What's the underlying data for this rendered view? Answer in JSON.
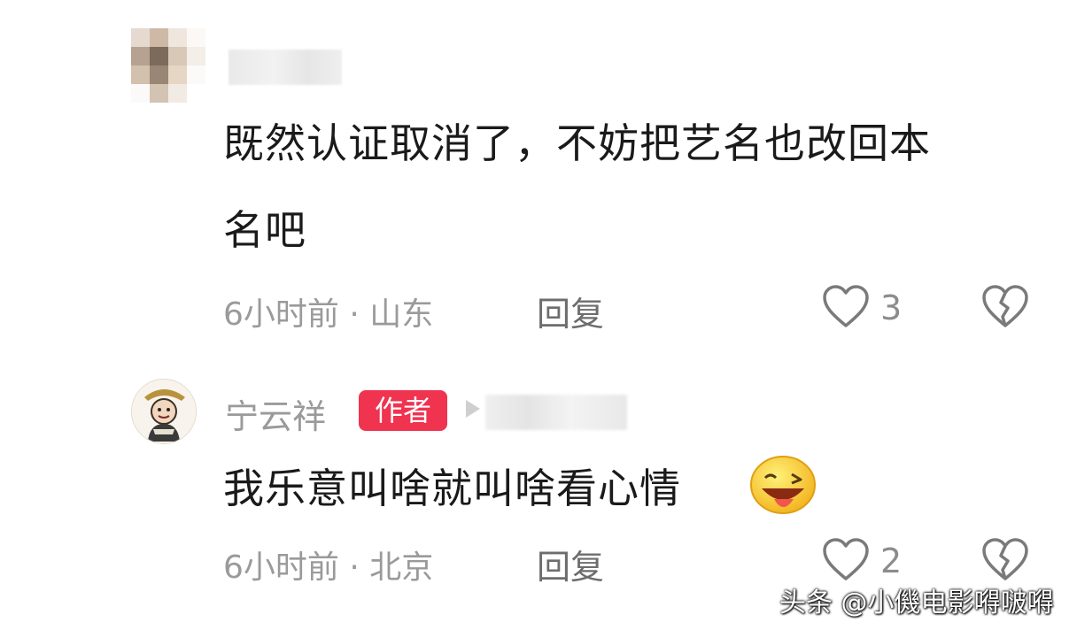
{
  "comment1": {
    "line1": "既然认证取消了，不妨把艺名也改回本",
    "line2": "名吧",
    "meta": "6小时前 · 山东",
    "reply": "回复",
    "likes": "3"
  },
  "comment2": {
    "author": "宁云祥",
    "badge": "作者",
    "text": "我乐意叫啥就叫啥看心情",
    "meta": "6小时前 · 北京",
    "reply": "回复",
    "likes": "2"
  },
  "icons": {
    "like": "heart-outline-icon",
    "dislike": "broken-heart-icon",
    "emoji": "winking-tongue-emoji"
  },
  "watermark": "头条 @小僟电影嘚啵嘚"
}
